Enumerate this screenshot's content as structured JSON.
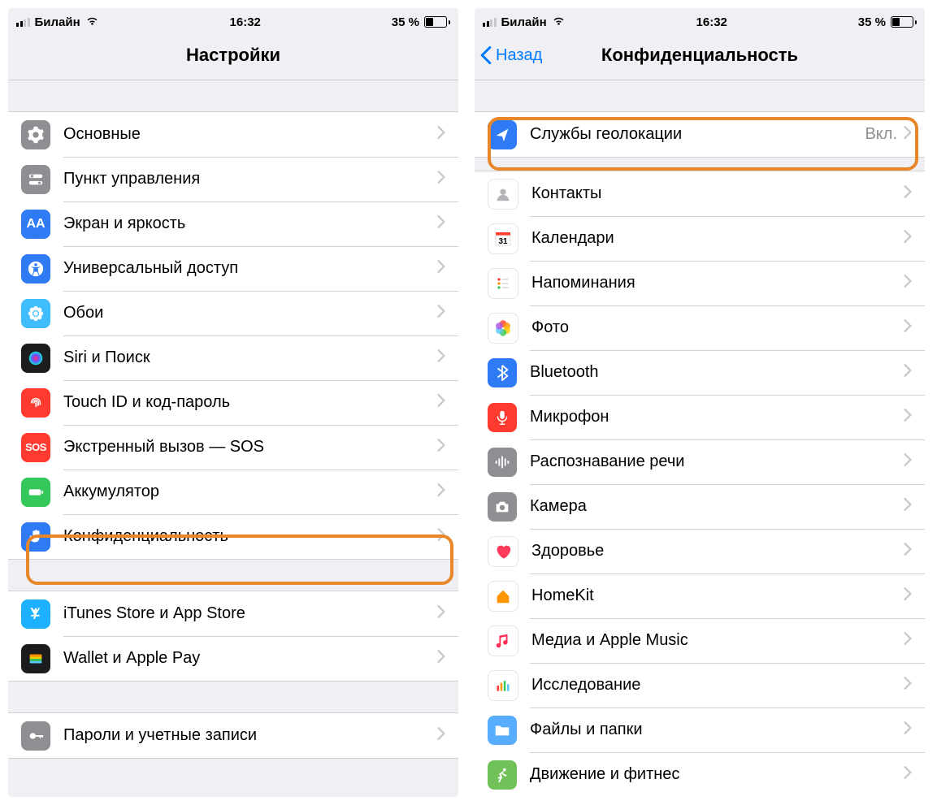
{
  "status": {
    "carrier": "Билайн",
    "time": "16:32",
    "battery": "35 %"
  },
  "left": {
    "title": "Настройки",
    "g1": [
      {
        "label": "Основные"
      },
      {
        "label": "Пункт управления"
      },
      {
        "label": "Экран и яркость"
      },
      {
        "label": "Универсальный доступ"
      },
      {
        "label": "Обои"
      },
      {
        "label": "Siri и Поиск"
      },
      {
        "label": "Touch ID и код-пароль"
      },
      {
        "label": "Экстренный вызов — SOS"
      },
      {
        "label": "Аккумулятор"
      },
      {
        "label": "Конфиденциальность"
      }
    ],
    "g2": [
      {
        "label": "iTunes Store и App Store"
      },
      {
        "label": "Wallet и Apple Pay"
      }
    ],
    "g3": [
      {
        "label": "Пароли и учетные записи"
      }
    ]
  },
  "right": {
    "back": "Назад",
    "title": "Конфиденциальность",
    "g1": [
      {
        "label": "Службы геолокации",
        "value": "Вкл."
      }
    ],
    "g2": [
      {
        "label": "Контакты"
      },
      {
        "label": "Календари"
      },
      {
        "label": "Напоминания"
      },
      {
        "label": "Фото"
      },
      {
        "label": "Bluetooth"
      },
      {
        "label": "Микрофон"
      },
      {
        "label": "Распознавание речи"
      },
      {
        "label": "Камера"
      },
      {
        "label": "Здоровье"
      },
      {
        "label": "HomeKit"
      },
      {
        "label": "Медиа и Apple Music"
      },
      {
        "label": "Исследование"
      },
      {
        "label": "Файлы и папки"
      },
      {
        "label": "Движение и фитнес"
      }
    ]
  }
}
